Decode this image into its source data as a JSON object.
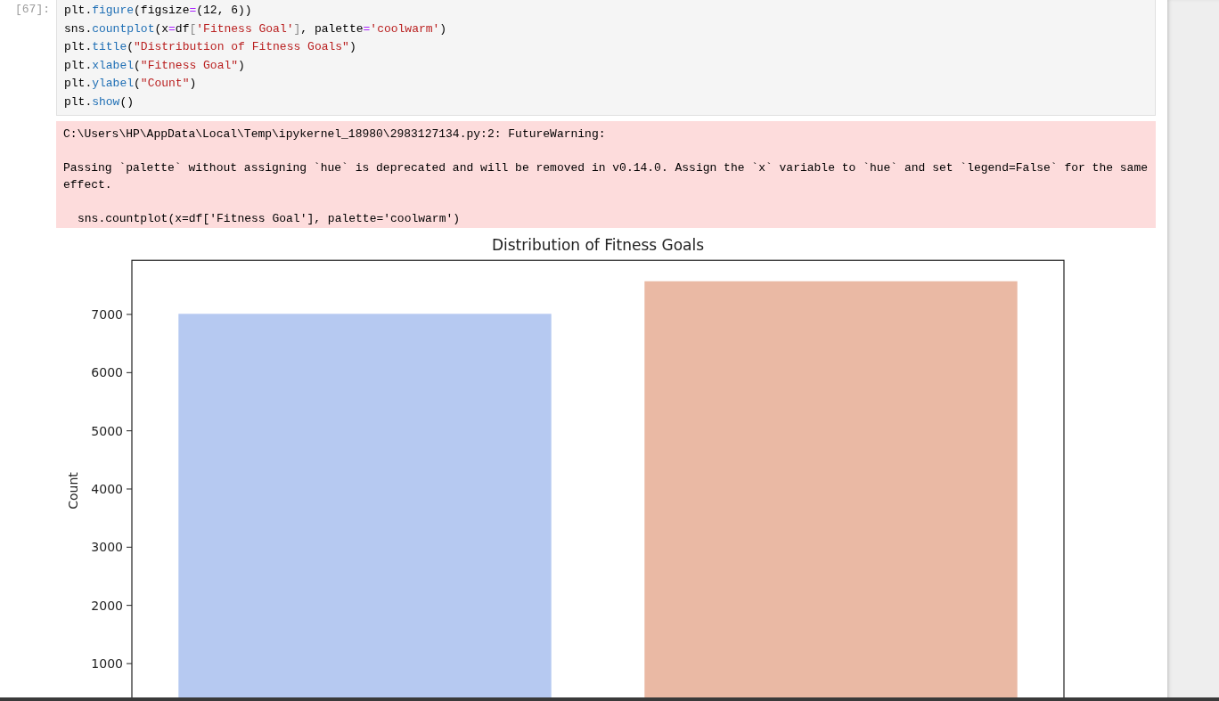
{
  "cell": {
    "prompt": "[67]:",
    "code_lines": [
      [
        {
          "kind": "plain",
          "text": "plt."
        },
        {
          "kind": "attr",
          "text": "figure"
        },
        {
          "kind": "plain",
          "text": "(figsize"
        },
        {
          "kind": "op",
          "text": "="
        },
        {
          "kind": "plain",
          "text": "(12, 6))"
        }
      ],
      [
        {
          "kind": "plain",
          "text": "sns."
        },
        {
          "kind": "attr",
          "text": "countplot"
        },
        {
          "kind": "plain",
          "text": "(x"
        },
        {
          "kind": "op",
          "text": "="
        },
        {
          "kind": "plain",
          "text": "df"
        },
        {
          "kind": "bracket",
          "text": "["
        },
        {
          "kind": "str",
          "text": "'Fitness Goal'"
        },
        {
          "kind": "bracket",
          "text": "]"
        },
        {
          "kind": "plain",
          "text": ", palette"
        },
        {
          "kind": "op",
          "text": "="
        },
        {
          "kind": "str",
          "text": "'coolwarm'"
        },
        {
          "kind": "plain",
          "text": ")"
        }
      ],
      [
        {
          "kind": "plain",
          "text": "plt."
        },
        {
          "kind": "attr",
          "text": "title"
        },
        {
          "kind": "plain",
          "text": "("
        },
        {
          "kind": "str",
          "text": "\"Distribution of Fitness Goals\""
        },
        {
          "kind": "plain",
          "text": ")"
        }
      ],
      [
        {
          "kind": "plain",
          "text": "plt."
        },
        {
          "kind": "attr",
          "text": "xlabel"
        },
        {
          "kind": "plain",
          "text": "("
        },
        {
          "kind": "str",
          "text": "\"Fitness Goal\""
        },
        {
          "kind": "plain",
          "text": ")"
        }
      ],
      [
        {
          "kind": "plain",
          "text": "plt."
        },
        {
          "kind": "attr",
          "text": "ylabel"
        },
        {
          "kind": "plain",
          "text": "("
        },
        {
          "kind": "str",
          "text": "\"Count\""
        },
        {
          "kind": "plain",
          "text": ")"
        }
      ],
      [
        {
          "kind": "plain",
          "text": "plt."
        },
        {
          "kind": "attr",
          "text": "show"
        },
        {
          "kind": "plain",
          "text": "()"
        }
      ]
    ],
    "warning": {
      "header": "C:\\Users\\HP\\AppData\\Local\\Temp\\ipykernel_18980\\2983127134.py:2: FutureWarning:",
      "message": "Passing `palette` without assigning `hue` is deprecated and will be removed in v0.14.0. Assign the `x` variable to `hue` and set `legend=False` for the same effect.",
      "source_line": "sns.countplot(x=df['Fitness Goal'], palette='coolwarm')"
    },
    "chart_data": {
      "type": "bar",
      "title": "Distribution of Fitness Goals",
      "ylabel": "Count",
      "values": [
        7010,
        7570
      ],
      "colors": [
        "#b6c9f1",
        "#eab9a4"
      ],
      "ylim": [
        0,
        7930
      ],
      "yticks": [
        1000,
        2000,
        3000,
        4000,
        5000,
        6000,
        7000
      ]
    }
  }
}
